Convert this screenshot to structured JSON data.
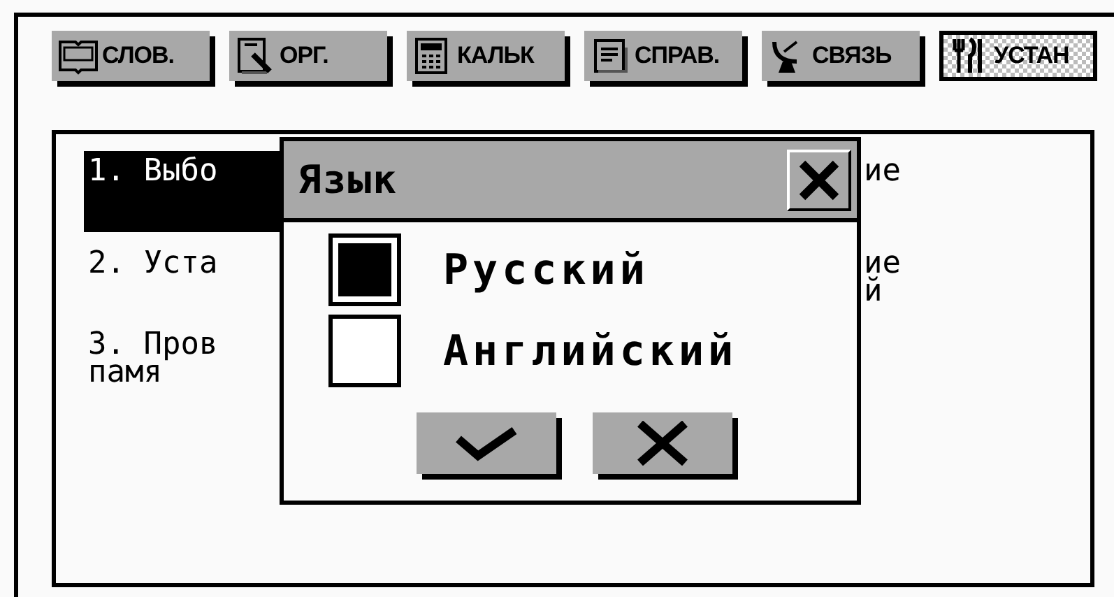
{
  "tabs": [
    {
      "label": "СЛОВ.",
      "selected": false
    },
    {
      "label": "ОРГ.",
      "selected": false
    },
    {
      "label": "КАЛЬК",
      "selected": false
    },
    {
      "label": "СПРАВ.",
      "selected": false
    },
    {
      "label": "СВЯЗЬ",
      "selected": false
    },
    {
      "label": "УСТАН",
      "selected": true
    }
  ],
  "list": {
    "items": [
      {
        "lines": [
          "1. Выбо"
        ],
        "right_lines": [
          "ие"
        ],
        "selected": true
      },
      {
        "lines": [
          "2. Уста"
        ],
        "right_lines": [
          "ие",
          "й"
        ],
        "selected": false
      },
      {
        "lines": [
          "3. Пров",
          "памя"
        ],
        "selected": false
      }
    ]
  },
  "dialog": {
    "title": "Язык",
    "options": [
      {
        "label": "Русский",
        "selected": true
      },
      {
        "label": "Английский",
        "selected": false
      }
    ]
  }
}
